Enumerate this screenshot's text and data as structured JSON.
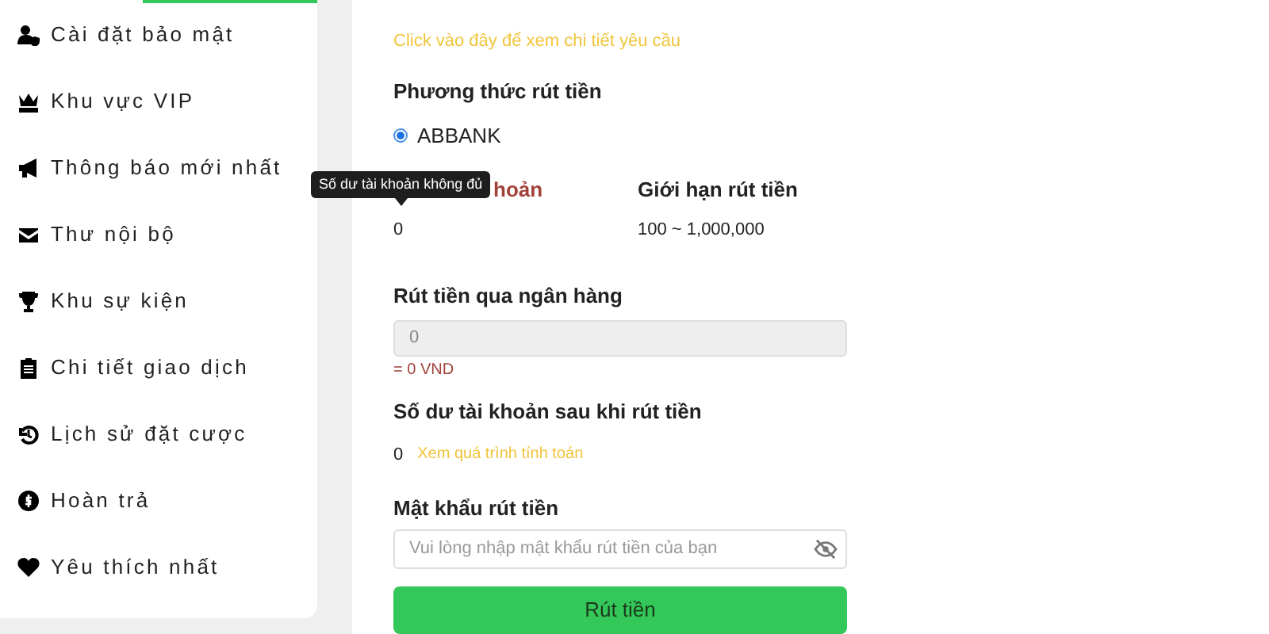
{
  "sidebar": {
    "items": [
      {
        "label": "Cài đặt bảo mật"
      },
      {
        "label": "Khu vực VIP"
      },
      {
        "label": "Thông báo mới nhất"
      },
      {
        "label": "Thư nội bộ"
      },
      {
        "label": "Khu sự kiện"
      },
      {
        "label": "Chi tiết giao dịch"
      },
      {
        "label": "Lịch sử đặt cược"
      },
      {
        "label": "Hoàn trả"
      },
      {
        "label": "Yêu thích nhất"
      }
    ]
  },
  "main": {
    "requirements_link": "Click vào đây để xem chi tiết yêu cầu",
    "method": {
      "heading": "Phương thức rút tiền",
      "options": [
        {
          "label": "ABBANK",
          "selected": true
        }
      ]
    },
    "balance": {
      "label": "hoản",
      "value": "0",
      "tooltip": "Số dư tài khoản không đủ"
    },
    "limit": {
      "label": "Giới hạn rút tiền",
      "value": "100 ~ 1,000,000"
    },
    "amount": {
      "heading": "Rút tiền qua ngân hàng",
      "value": "0",
      "disabled": true,
      "converted": "= 0 VND"
    },
    "after": {
      "heading": "Số dư tài khoản sau khi rút tiền",
      "value": "0",
      "link": "Xem quá trình tính toán"
    },
    "password": {
      "heading": "Mật khẩu rút tiền",
      "placeholder": "Vui lòng nhập mật khẩu rút tiền của bạn"
    },
    "submit": "Rút tiền"
  }
}
